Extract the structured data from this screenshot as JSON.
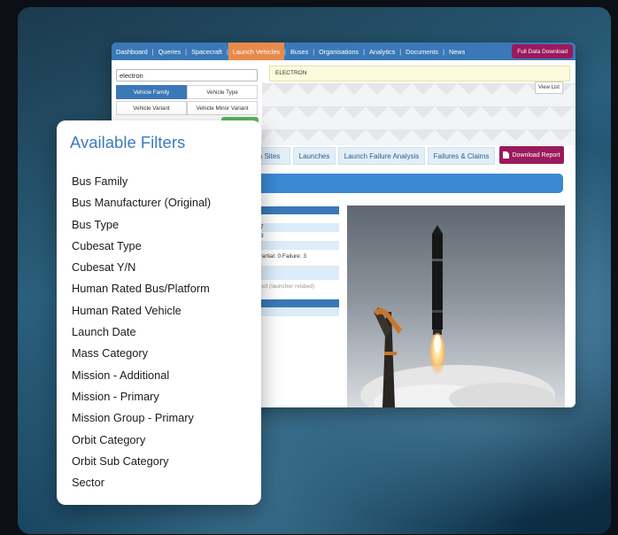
{
  "nav": {
    "items": [
      {
        "label": "Dashboard",
        "active": false
      },
      {
        "label": "Queries",
        "active": false
      },
      {
        "label": "Spacecraft",
        "active": false
      },
      {
        "label": "Launch Vehicles",
        "active": true
      },
      {
        "label": "Buses",
        "active": false
      },
      {
        "label": "Organisations",
        "active": false
      },
      {
        "label": "Analytics",
        "active": false
      },
      {
        "label": "Documents",
        "active": false
      },
      {
        "label": "News",
        "active": false
      }
    ],
    "download_label": "Full Data Download"
  },
  "search": {
    "value": "electron"
  },
  "segments": {
    "vehicle_family": "Vehicle Family",
    "vehicle_type": "Vehicle Type",
    "vehicle_variant": "Vehicle Variant",
    "vehicle_minor_variant": "Vehicle Minor Variant"
  },
  "result": {
    "selected": "ELECTRON",
    "view_list_label": "View List"
  },
  "tabs": [
    "ch Sites",
    "Launches",
    "Launch Failure Analysis",
    "Failures & Claims"
  ],
  "download_report_label": "Download Report",
  "details": {
    "rows": [
      "7",
      "3",
      "0 Partial: 0 Failure: 3"
    ],
    "note": "rs not (launcher related)"
  },
  "filters": {
    "title": "Available Filters",
    "items": [
      "Bus Family",
      "Bus Manufacturer (Original)",
      "Bus Type",
      "Cubesat Type",
      "Cubesat Y/N",
      "Human Rated Bus/Platform",
      "Human Rated Vehicle",
      "Launch Date",
      "Mass Category",
      "Mission - Additional",
      "Mission - Primary",
      "Mission Group - Primary",
      "Orbit Category",
      "Orbit Sub Category",
      "Sector"
    ]
  },
  "colors": {
    "nav_blue": "#3a78b7",
    "nav_active": "#e88a4c",
    "accent_magenta": "#9b1a5c",
    "title_blue": "#3b7bbf"
  }
}
